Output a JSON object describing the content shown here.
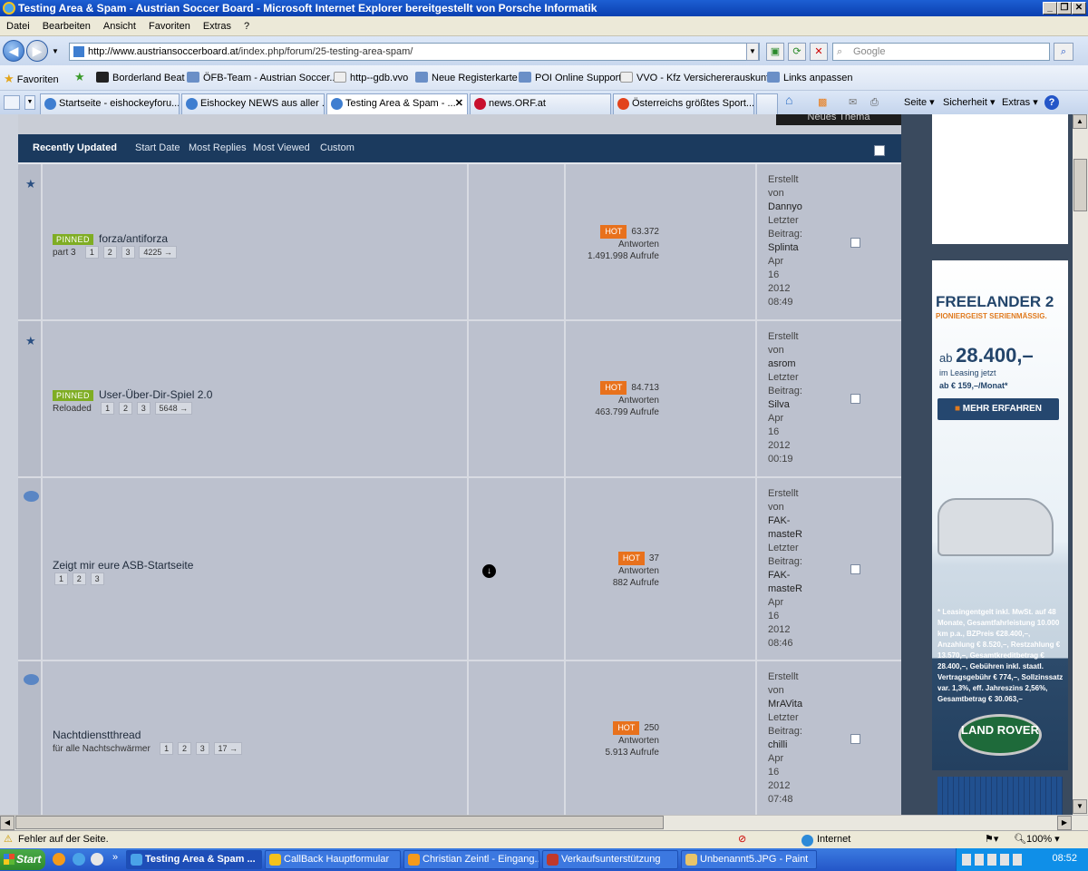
{
  "window": {
    "title": "Testing Area & Spam - Austrian Soccer Board - Microsoft Internet Explorer bereitgestellt von Porsche Informatik"
  },
  "menu": [
    "Datei",
    "Bearbeiten",
    "Ansicht",
    "Favoriten",
    "Extras",
    "?"
  ],
  "address": {
    "url_host": "http://www.austriansoccerboard.at",
    "url_path": "/index.php/forum/25-testing-area-spam/"
  },
  "search": {
    "placeholder": "Google"
  },
  "favorites": {
    "label": "Favoriten",
    "items": [
      "Borderland Beat",
      "ÖFB-Team - Austrian Soccer...",
      "http--gdb.vvo",
      "Neue Registerkarte",
      "POI Online Support",
      "VVO - Kfz Versichererauskunft",
      "Links anpassen"
    ]
  },
  "tabs": [
    "Startseite - eishockeyforu...",
    "Eishockey NEWS aus aller ...",
    "Testing Area & Spam - ...",
    "news.ORF.at",
    "Österreichs größtes Sport..."
  ],
  "commandbar": {
    "seite": "Seite ▾",
    "sicherheit": "Sicherheit ▾",
    "extras": "Extras ▾"
  },
  "forum": {
    "new_topic": "Neues Thema",
    "header_tabs": [
      "Recently Updated",
      "Start Date",
      "Most Replies",
      "Most Viewed",
      "Custom"
    ],
    "threads": [
      {
        "pinned": "PINNED",
        "title": "forza/antiforza",
        "subtitle": "part 3",
        "pages": [
          "1",
          "2",
          "3",
          "4225 →"
        ],
        "hot": "HOT",
        "replies": "63.372",
        "replies_label": "Antworten",
        "views": "1.491.998 Aufrufe",
        "last": [
          "Erstellt",
          "von",
          "Dannyo",
          "Letzter",
          "Beitrag:",
          "Splinta",
          "Apr",
          "16",
          "2012",
          "08:49"
        ]
      },
      {
        "pinned": "PINNED",
        "title": "User-Über-Dir-Spiel 2.0",
        "subtitle": "Reloaded",
        "pages": [
          "1",
          "2",
          "3",
          "5648 →"
        ],
        "hot": "HOT",
        "replies": "84.713",
        "replies_label": "Antworten",
        "views": "463.799 Aufrufe",
        "last": [
          "Erstellt",
          "von",
          "asrom",
          "Letzter",
          "Beitrag:",
          "Silva",
          "Apr",
          "16",
          "2012",
          "00:19"
        ]
      },
      {
        "pinned": "",
        "title": "Zeigt mir eure ASB-Startseite",
        "subtitle": "",
        "pages": [
          "1",
          "2",
          "3"
        ],
        "hot": "HOT",
        "replies": "37",
        "replies_label": "Antworten",
        "views": "882 Aufrufe",
        "last": [
          "Erstellt",
          "von",
          "FAK-",
          "masteR",
          "Letzter",
          "Beitrag:",
          "FAK-",
          "masteR",
          "Apr",
          "16",
          "2012",
          "08:46"
        ]
      },
      {
        "pinned": "",
        "title": "Nachtdienstthread",
        "subtitle": "für alle Nachtschwärmer",
        "pages": [
          "1",
          "2",
          "3",
          "17 →"
        ],
        "hot": "HOT",
        "replies": "250",
        "replies_label": "Antworten",
        "views": "5.913 Aufrufe",
        "last": [
          "Erstellt",
          "von",
          "MrAVita",
          "Letzter",
          "Beitrag:",
          "chilli",
          "Apr",
          "16",
          "2012",
          "07:48"
        ]
      }
    ]
  },
  "ad": {
    "headline": "FREELANDER 2",
    "tagline": "PIONIERGEIST SERIENMÄSSIG.",
    "price_prefix": "ab",
    "price": "28.400,–",
    "leasing": "im Leasing jetzt",
    "monthly": "ab € 159,–/Monat*",
    "button": "MEHR ERFAHREN",
    "fine_print": "* Leasingentgelt inkl. MwSt. auf 48 Monate, Gesamtfahrleistung 10.000 km p.a., BZPreis €28.400,–, Anzahlung € 8.520,–, Restzahlung € 13.570,–, Gesamtkreditbetrag € 28.400,–, Gebühren inkl. staatl. Vertragsgebühr € 774,–, Sollzinssatz var. 1,3%, eff. Jahreszins 2,56%, Gesamtbetrag € 30.063,–",
    "logo": "LAND ROVER"
  },
  "status": {
    "message": "Fehler auf der Seite.",
    "zone": "Internet",
    "zoom": "100%"
  },
  "taskbar": {
    "start": "Start",
    "tasks": [
      "Testing Area & Spam ...",
      "CallBack Hauptformular",
      "Christian Zeintl - Eingang...",
      "Verkaufsunterstützung",
      "Unbenannt5.JPG - Paint"
    ],
    "time": "08:52"
  }
}
